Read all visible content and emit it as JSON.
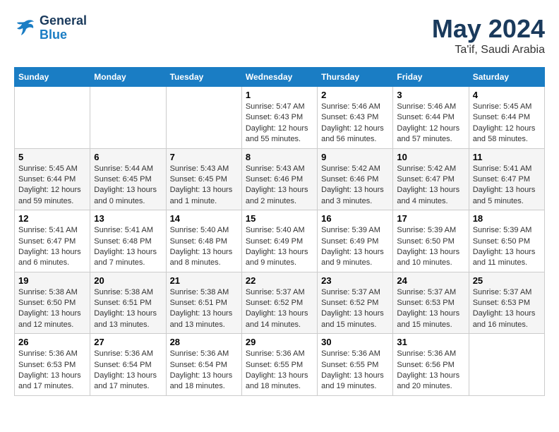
{
  "header": {
    "logo_line1": "General",
    "logo_line2": "Blue",
    "title": "May 2024",
    "subtitle": "Ta'if, Saudi Arabia"
  },
  "weekdays": [
    "Sunday",
    "Monday",
    "Tuesday",
    "Wednesday",
    "Thursday",
    "Friday",
    "Saturday"
  ],
  "weeks": [
    [
      {
        "day": "",
        "sunrise": "",
        "sunset": "",
        "daylight": ""
      },
      {
        "day": "",
        "sunrise": "",
        "sunset": "",
        "daylight": ""
      },
      {
        "day": "",
        "sunrise": "",
        "sunset": "",
        "daylight": ""
      },
      {
        "day": "1",
        "sunrise": "Sunrise: 5:47 AM",
        "sunset": "Sunset: 6:43 PM",
        "daylight": "Daylight: 12 hours and 55 minutes."
      },
      {
        "day": "2",
        "sunrise": "Sunrise: 5:46 AM",
        "sunset": "Sunset: 6:43 PM",
        "daylight": "Daylight: 12 hours and 56 minutes."
      },
      {
        "day": "3",
        "sunrise": "Sunrise: 5:46 AM",
        "sunset": "Sunset: 6:44 PM",
        "daylight": "Daylight: 12 hours and 57 minutes."
      },
      {
        "day": "4",
        "sunrise": "Sunrise: 5:45 AM",
        "sunset": "Sunset: 6:44 PM",
        "daylight": "Daylight: 12 hours and 58 minutes."
      }
    ],
    [
      {
        "day": "5",
        "sunrise": "Sunrise: 5:45 AM",
        "sunset": "Sunset: 6:44 PM",
        "daylight": "Daylight: 12 hours and 59 minutes."
      },
      {
        "day": "6",
        "sunrise": "Sunrise: 5:44 AM",
        "sunset": "Sunset: 6:45 PM",
        "daylight": "Daylight: 13 hours and 0 minutes."
      },
      {
        "day": "7",
        "sunrise": "Sunrise: 5:43 AM",
        "sunset": "Sunset: 6:45 PM",
        "daylight": "Daylight: 13 hours and 1 minute."
      },
      {
        "day": "8",
        "sunrise": "Sunrise: 5:43 AM",
        "sunset": "Sunset: 6:46 PM",
        "daylight": "Daylight: 13 hours and 2 minutes."
      },
      {
        "day": "9",
        "sunrise": "Sunrise: 5:42 AM",
        "sunset": "Sunset: 6:46 PM",
        "daylight": "Daylight: 13 hours and 3 minutes."
      },
      {
        "day": "10",
        "sunrise": "Sunrise: 5:42 AM",
        "sunset": "Sunset: 6:47 PM",
        "daylight": "Daylight: 13 hours and 4 minutes."
      },
      {
        "day": "11",
        "sunrise": "Sunrise: 5:41 AM",
        "sunset": "Sunset: 6:47 PM",
        "daylight": "Daylight: 13 hours and 5 minutes."
      }
    ],
    [
      {
        "day": "12",
        "sunrise": "Sunrise: 5:41 AM",
        "sunset": "Sunset: 6:47 PM",
        "daylight": "Daylight: 13 hours and 6 minutes."
      },
      {
        "day": "13",
        "sunrise": "Sunrise: 5:41 AM",
        "sunset": "Sunset: 6:48 PM",
        "daylight": "Daylight: 13 hours and 7 minutes."
      },
      {
        "day": "14",
        "sunrise": "Sunrise: 5:40 AM",
        "sunset": "Sunset: 6:48 PM",
        "daylight": "Daylight: 13 hours and 8 minutes."
      },
      {
        "day": "15",
        "sunrise": "Sunrise: 5:40 AM",
        "sunset": "Sunset: 6:49 PM",
        "daylight": "Daylight: 13 hours and 9 minutes."
      },
      {
        "day": "16",
        "sunrise": "Sunrise: 5:39 AM",
        "sunset": "Sunset: 6:49 PM",
        "daylight": "Daylight: 13 hours and 9 minutes."
      },
      {
        "day": "17",
        "sunrise": "Sunrise: 5:39 AM",
        "sunset": "Sunset: 6:50 PM",
        "daylight": "Daylight: 13 hours and 10 minutes."
      },
      {
        "day": "18",
        "sunrise": "Sunrise: 5:39 AM",
        "sunset": "Sunset: 6:50 PM",
        "daylight": "Daylight: 13 hours and 11 minutes."
      }
    ],
    [
      {
        "day": "19",
        "sunrise": "Sunrise: 5:38 AM",
        "sunset": "Sunset: 6:50 PM",
        "daylight": "Daylight: 13 hours and 12 minutes."
      },
      {
        "day": "20",
        "sunrise": "Sunrise: 5:38 AM",
        "sunset": "Sunset: 6:51 PM",
        "daylight": "Daylight: 13 hours and 13 minutes."
      },
      {
        "day": "21",
        "sunrise": "Sunrise: 5:38 AM",
        "sunset": "Sunset: 6:51 PM",
        "daylight": "Daylight: 13 hours and 13 minutes."
      },
      {
        "day": "22",
        "sunrise": "Sunrise: 5:37 AM",
        "sunset": "Sunset: 6:52 PM",
        "daylight": "Daylight: 13 hours and 14 minutes."
      },
      {
        "day": "23",
        "sunrise": "Sunrise: 5:37 AM",
        "sunset": "Sunset: 6:52 PM",
        "daylight": "Daylight: 13 hours and 15 minutes."
      },
      {
        "day": "24",
        "sunrise": "Sunrise: 5:37 AM",
        "sunset": "Sunset: 6:53 PM",
        "daylight": "Daylight: 13 hours and 15 minutes."
      },
      {
        "day": "25",
        "sunrise": "Sunrise: 5:37 AM",
        "sunset": "Sunset: 6:53 PM",
        "daylight": "Daylight: 13 hours and 16 minutes."
      }
    ],
    [
      {
        "day": "26",
        "sunrise": "Sunrise: 5:36 AM",
        "sunset": "Sunset: 6:53 PM",
        "daylight": "Daylight: 13 hours and 17 minutes."
      },
      {
        "day": "27",
        "sunrise": "Sunrise: 5:36 AM",
        "sunset": "Sunset: 6:54 PM",
        "daylight": "Daylight: 13 hours and 17 minutes."
      },
      {
        "day": "28",
        "sunrise": "Sunrise: 5:36 AM",
        "sunset": "Sunset: 6:54 PM",
        "daylight": "Daylight: 13 hours and 18 minutes."
      },
      {
        "day": "29",
        "sunrise": "Sunrise: 5:36 AM",
        "sunset": "Sunset: 6:55 PM",
        "daylight": "Daylight: 13 hours and 18 minutes."
      },
      {
        "day": "30",
        "sunrise": "Sunrise: 5:36 AM",
        "sunset": "Sunset: 6:55 PM",
        "daylight": "Daylight: 13 hours and 19 minutes."
      },
      {
        "day": "31",
        "sunrise": "Sunrise: 5:36 AM",
        "sunset": "Sunset: 6:56 PM",
        "daylight": "Daylight: 13 hours and 20 minutes."
      },
      {
        "day": "",
        "sunrise": "",
        "sunset": "",
        "daylight": ""
      }
    ]
  ]
}
